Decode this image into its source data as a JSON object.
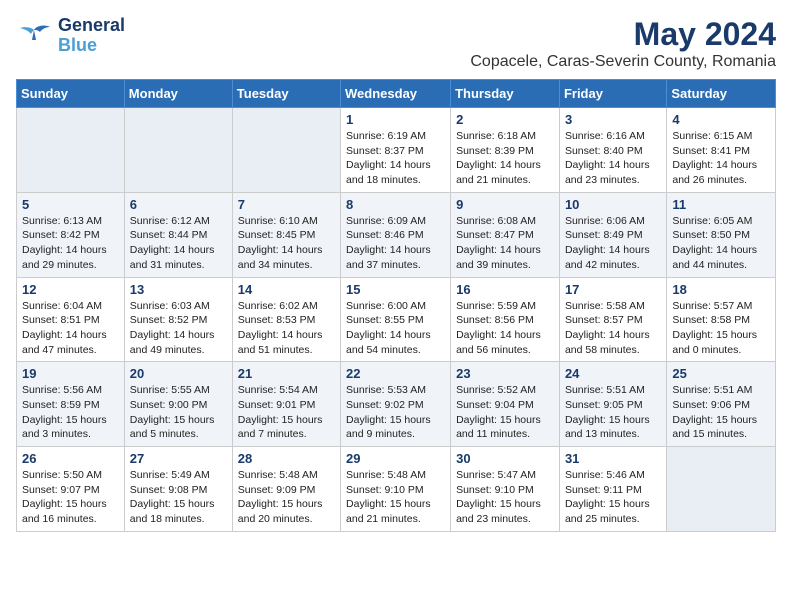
{
  "header": {
    "logo_line1": "General",
    "logo_line2": "Blue",
    "title": "May 2024",
    "subtitle": "Copacele, Caras-Severin County, Romania"
  },
  "weekdays": [
    "Sunday",
    "Monday",
    "Tuesday",
    "Wednesday",
    "Thursday",
    "Friday",
    "Saturday"
  ],
  "weeks": [
    [
      {
        "day": "",
        "info": ""
      },
      {
        "day": "",
        "info": ""
      },
      {
        "day": "",
        "info": ""
      },
      {
        "day": "1",
        "info": "Sunrise: 6:19 AM\nSunset: 8:37 PM\nDaylight: 14 hours\nand 18 minutes."
      },
      {
        "day": "2",
        "info": "Sunrise: 6:18 AM\nSunset: 8:39 PM\nDaylight: 14 hours\nand 21 minutes."
      },
      {
        "day": "3",
        "info": "Sunrise: 6:16 AM\nSunset: 8:40 PM\nDaylight: 14 hours\nand 23 minutes."
      },
      {
        "day": "4",
        "info": "Sunrise: 6:15 AM\nSunset: 8:41 PM\nDaylight: 14 hours\nand 26 minutes."
      }
    ],
    [
      {
        "day": "5",
        "info": "Sunrise: 6:13 AM\nSunset: 8:42 PM\nDaylight: 14 hours\nand 29 minutes."
      },
      {
        "day": "6",
        "info": "Sunrise: 6:12 AM\nSunset: 8:44 PM\nDaylight: 14 hours\nand 31 minutes."
      },
      {
        "day": "7",
        "info": "Sunrise: 6:10 AM\nSunset: 8:45 PM\nDaylight: 14 hours\nand 34 minutes."
      },
      {
        "day": "8",
        "info": "Sunrise: 6:09 AM\nSunset: 8:46 PM\nDaylight: 14 hours\nand 37 minutes."
      },
      {
        "day": "9",
        "info": "Sunrise: 6:08 AM\nSunset: 8:47 PM\nDaylight: 14 hours\nand 39 minutes."
      },
      {
        "day": "10",
        "info": "Sunrise: 6:06 AM\nSunset: 8:49 PM\nDaylight: 14 hours\nand 42 minutes."
      },
      {
        "day": "11",
        "info": "Sunrise: 6:05 AM\nSunset: 8:50 PM\nDaylight: 14 hours\nand 44 minutes."
      }
    ],
    [
      {
        "day": "12",
        "info": "Sunrise: 6:04 AM\nSunset: 8:51 PM\nDaylight: 14 hours\nand 47 minutes."
      },
      {
        "day": "13",
        "info": "Sunrise: 6:03 AM\nSunset: 8:52 PM\nDaylight: 14 hours\nand 49 minutes."
      },
      {
        "day": "14",
        "info": "Sunrise: 6:02 AM\nSunset: 8:53 PM\nDaylight: 14 hours\nand 51 minutes."
      },
      {
        "day": "15",
        "info": "Sunrise: 6:00 AM\nSunset: 8:55 PM\nDaylight: 14 hours\nand 54 minutes."
      },
      {
        "day": "16",
        "info": "Sunrise: 5:59 AM\nSunset: 8:56 PM\nDaylight: 14 hours\nand 56 minutes."
      },
      {
        "day": "17",
        "info": "Sunrise: 5:58 AM\nSunset: 8:57 PM\nDaylight: 14 hours\nand 58 minutes."
      },
      {
        "day": "18",
        "info": "Sunrise: 5:57 AM\nSunset: 8:58 PM\nDaylight: 15 hours\nand 0 minutes."
      }
    ],
    [
      {
        "day": "19",
        "info": "Sunrise: 5:56 AM\nSunset: 8:59 PM\nDaylight: 15 hours\nand 3 minutes."
      },
      {
        "day": "20",
        "info": "Sunrise: 5:55 AM\nSunset: 9:00 PM\nDaylight: 15 hours\nand 5 minutes."
      },
      {
        "day": "21",
        "info": "Sunrise: 5:54 AM\nSunset: 9:01 PM\nDaylight: 15 hours\nand 7 minutes."
      },
      {
        "day": "22",
        "info": "Sunrise: 5:53 AM\nSunset: 9:02 PM\nDaylight: 15 hours\nand 9 minutes."
      },
      {
        "day": "23",
        "info": "Sunrise: 5:52 AM\nSunset: 9:04 PM\nDaylight: 15 hours\nand 11 minutes."
      },
      {
        "day": "24",
        "info": "Sunrise: 5:51 AM\nSunset: 9:05 PM\nDaylight: 15 hours\nand 13 minutes."
      },
      {
        "day": "25",
        "info": "Sunrise: 5:51 AM\nSunset: 9:06 PM\nDaylight: 15 hours\nand 15 minutes."
      }
    ],
    [
      {
        "day": "26",
        "info": "Sunrise: 5:50 AM\nSunset: 9:07 PM\nDaylight: 15 hours\nand 16 minutes."
      },
      {
        "day": "27",
        "info": "Sunrise: 5:49 AM\nSunset: 9:08 PM\nDaylight: 15 hours\nand 18 minutes."
      },
      {
        "day": "28",
        "info": "Sunrise: 5:48 AM\nSunset: 9:09 PM\nDaylight: 15 hours\nand 20 minutes."
      },
      {
        "day": "29",
        "info": "Sunrise: 5:48 AM\nSunset: 9:10 PM\nDaylight: 15 hours\nand 21 minutes."
      },
      {
        "day": "30",
        "info": "Sunrise: 5:47 AM\nSunset: 9:10 PM\nDaylight: 15 hours\nand 23 minutes."
      },
      {
        "day": "31",
        "info": "Sunrise: 5:46 AM\nSunset: 9:11 PM\nDaylight: 15 hours\nand 25 minutes."
      },
      {
        "day": "",
        "info": ""
      }
    ]
  ]
}
